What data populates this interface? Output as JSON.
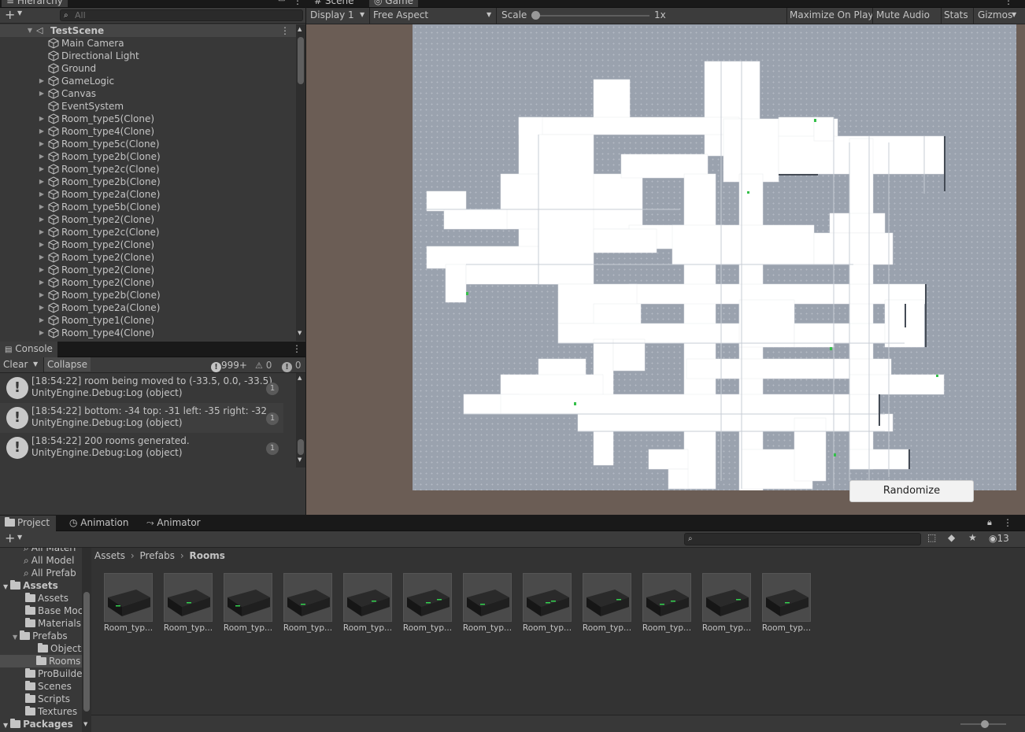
{
  "hierarchy": {
    "tab_label": "Hierarchy",
    "search_placeholder": "All",
    "scene_name": "TestScene",
    "items": [
      {
        "label": "Main Camera",
        "expandable": false
      },
      {
        "label": "Directional Light",
        "expandable": false
      },
      {
        "label": "Ground",
        "expandable": false
      },
      {
        "label": "GameLogic",
        "expandable": true
      },
      {
        "label": "Canvas",
        "expandable": true
      },
      {
        "label": "EventSystem",
        "expandable": false
      },
      {
        "label": "Room_type5(Clone)",
        "expandable": true
      },
      {
        "label": "Room_type4(Clone)",
        "expandable": true
      },
      {
        "label": "Room_type5c(Clone)",
        "expandable": true
      },
      {
        "label": "Room_type2b(Clone)",
        "expandable": true
      },
      {
        "label": "Room_type2c(Clone)",
        "expandable": true
      },
      {
        "label": "Room_type2b(Clone)",
        "expandable": true
      },
      {
        "label": "Room_type2a(Clone)",
        "expandable": true
      },
      {
        "label": "Room_type5b(Clone)",
        "expandable": true
      },
      {
        "label": "Room_type2(Clone)",
        "expandable": true
      },
      {
        "label": "Room_type2c(Clone)",
        "expandable": true
      },
      {
        "label": "Room_type2(Clone)",
        "expandable": true
      },
      {
        "label": "Room_type2(Clone)",
        "expandable": true
      },
      {
        "label": "Room_type2(Clone)",
        "expandable": true
      },
      {
        "label": "Room_type2(Clone)",
        "expandable": true
      },
      {
        "label": "Room_type2b(Clone)",
        "expandable": true
      },
      {
        "label": "Room_type2a(Clone)",
        "expandable": true
      },
      {
        "label": "Room_type1(Clone)",
        "expandable": true
      },
      {
        "label": "Room_type4(Clone)",
        "expandable": true
      }
    ]
  },
  "game": {
    "tab_scene": "Scene",
    "tab_game": "Game",
    "display": "Display 1",
    "aspect": "Free Aspect",
    "scale_label": "Scale",
    "scale_value": "1x",
    "maximize": "Maximize On Play",
    "mute": "Mute Audio",
    "stats": "Stats",
    "gizmos": "Gizmos",
    "randomize": "Randomize"
  },
  "console": {
    "tab_label": "Console",
    "clear": "Clear",
    "collapse": "Collapse",
    "count_log": "999+",
    "count_warn": "0",
    "count_err": "0",
    "entries": [
      {
        "line1": "[18:54:22] room being moved to (-33.5, 0.0, -33.5)",
        "line2": "UnityEngine.Debug:Log (object)",
        "count": "1"
      },
      {
        "line1": "[18:54:22] bottom: -34  top: -31  left: -35  right: -32",
        "line2": "UnityEngine.Debug:Log (object)",
        "count": "1"
      },
      {
        "line1": "[18:54:22] 200 rooms generated.",
        "line2": "UnityEngine.Debug:Log (object)",
        "count": "1"
      }
    ]
  },
  "project": {
    "tab_project": "Project",
    "tab_animation": "Animation",
    "tab_animator": "Animator",
    "hidden_count": "13",
    "breadcrumb": [
      "Assets",
      "Prefabs",
      "Rooms"
    ],
    "tree": [
      {
        "label": "All Materi",
        "indent": 1,
        "kind": "search"
      },
      {
        "label": "All Model",
        "indent": 1,
        "kind": "search"
      },
      {
        "label": "All Prefab",
        "indent": 1,
        "kind": "search"
      },
      {
        "label": "Assets",
        "indent": 0,
        "kind": "root"
      },
      {
        "label": "Assets",
        "indent": 1,
        "kind": "folder"
      },
      {
        "label": "Base Moc",
        "indent": 1,
        "kind": "folder"
      },
      {
        "label": "Materials",
        "indent": 1,
        "kind": "folder"
      },
      {
        "label": "Prefabs",
        "indent": 1,
        "kind": "open"
      },
      {
        "label": "Objects",
        "indent": 2,
        "kind": "folder"
      },
      {
        "label": "Rooms",
        "indent": 2,
        "kind": "selected"
      },
      {
        "label": "ProBuilde",
        "indent": 1,
        "kind": "folder"
      },
      {
        "label": "Scenes",
        "indent": 1,
        "kind": "folder"
      },
      {
        "label": "Scripts",
        "indent": 1,
        "kind": "folder"
      },
      {
        "label": "Textures",
        "indent": 1,
        "kind": "folder"
      },
      {
        "label": "Packages",
        "indent": 0,
        "kind": "root"
      }
    ],
    "assets": [
      "Room_typ...",
      "Room_typ...",
      "Room_typ...",
      "Room_typ...",
      "Room_typ...",
      "Room_typ...",
      "Room_typ...",
      "Room_typ...",
      "Room_typ...",
      "Room_typ...",
      "Room_typ...",
      "Room_typ..."
    ]
  },
  "icons": {
    "add": "plus-icon",
    "dropdown": "chevron-down-icon",
    "search": "search-icon",
    "menu": "kebab-menu-icon",
    "lock": "lock-icon",
    "scene": "unity-scene-icon",
    "gameobject": "cube-icon",
    "info": "info-icon",
    "warning": "warning-icon",
    "error": "error-icon"
  }
}
